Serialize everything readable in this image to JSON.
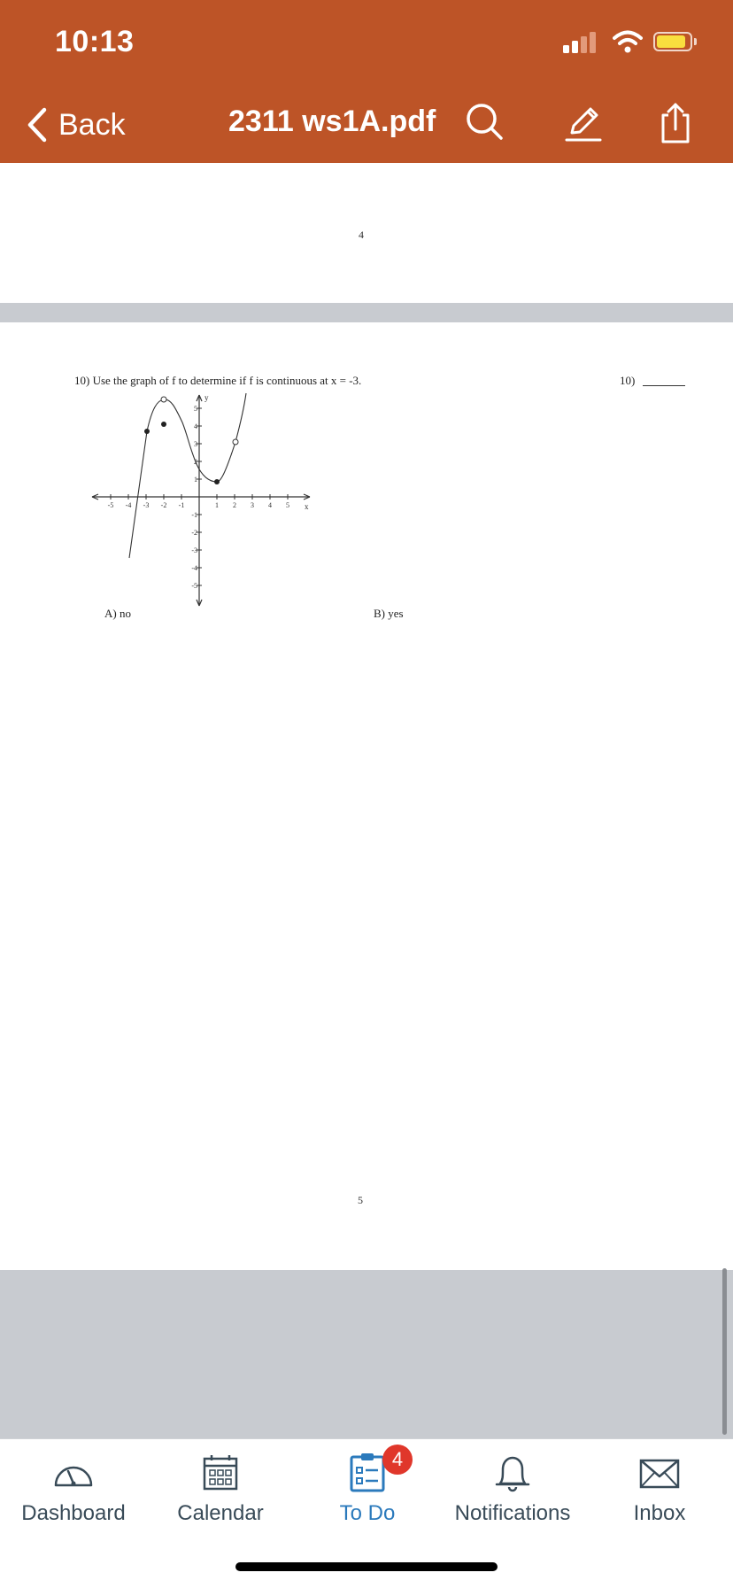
{
  "status_bar": {
    "time": "10:13"
  },
  "nav": {
    "back_label": "Back",
    "title": "2311 ws1A.pdf",
    "icons": [
      "search-icon",
      "annotate-pen-icon",
      "share-icon"
    ]
  },
  "pdf": {
    "page_top_number": "4",
    "question_text": "10) Use the graph of f to determine if f is continuous at x = -3.",
    "answer_label": "10)",
    "choices": [
      {
        "label": "A) no"
      },
      {
        "label": "B) yes"
      }
    ],
    "graph": {
      "axis_y_label": "y",
      "axis_x_label": "x",
      "x_ticks": [
        "-5",
        "-4",
        "-3",
        "-2",
        "-1",
        "1",
        "2",
        "3",
        "4",
        "5"
      ],
      "y_ticks": [
        "5",
        "4",
        "3",
        "2",
        "1",
        "-1",
        "-2",
        "-3",
        "-4",
        "-5"
      ]
    },
    "page_bottom_number": "5"
  },
  "tabbar": {
    "items": [
      {
        "label": "Dashboard",
        "icon": "dashboard-gauge-icon"
      },
      {
        "label": "Calendar",
        "icon": "calendar-icon"
      },
      {
        "label": "To Do",
        "icon": "todo-clipboard-icon",
        "badge": "4",
        "active": true
      },
      {
        "label": "Notifications",
        "icon": "bell-icon"
      },
      {
        "label": "Inbox",
        "icon": "envelope-icon"
      }
    ]
  },
  "colors": {
    "header": "#bd5427",
    "active_tab": "#2b7abc",
    "inactive_tab": "#394b58",
    "badge": "#e0372b",
    "battery": "#f9df3e"
  }
}
